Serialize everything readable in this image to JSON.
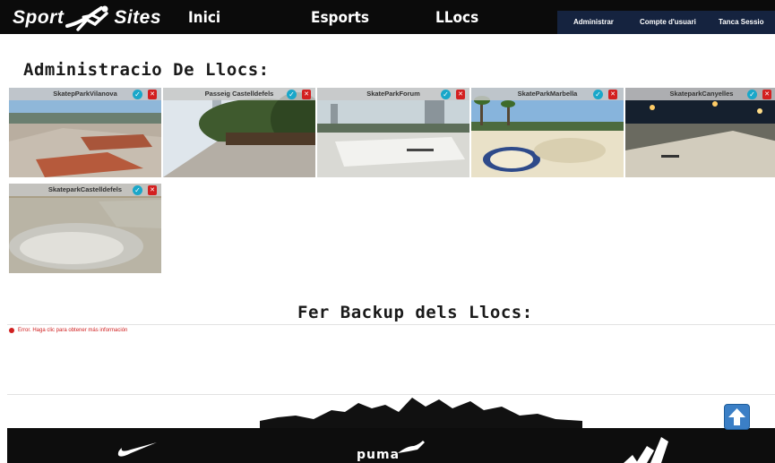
{
  "header": {
    "logo_left": "Sport",
    "logo_right": "Sites",
    "nav": [
      "Inici",
      "Esports",
      "LLocs"
    ],
    "account_links": [
      "Administrar",
      "Compte d'usuari",
      "Tanca Sessio"
    ]
  },
  "places_section": {
    "title": "Administracio De Llocs:",
    "cards": [
      {
        "label": "SkatepParkVilanova",
        "ok_icon": "check-icon",
        "delete_icon": "trash-icon"
      },
      {
        "label": "Passeig Castelldefels",
        "ok_icon": "check-icon",
        "delete_icon": "trash-icon"
      },
      {
        "label": "SkateParkForum",
        "ok_icon": "check-icon",
        "delete_icon": "trash-icon"
      },
      {
        "label": "SkateParkMarbella",
        "ok_icon": "check-icon",
        "delete_icon": "trash-icon"
      },
      {
        "label": "SkateparkCanyelles",
        "ok_icon": "check-icon",
        "delete_icon": "trash-icon"
      },
      {
        "label": "SkateparkCastelldefels",
        "ok_icon": "check-icon",
        "delete_icon": "trash-icon"
      }
    ]
  },
  "backup_section": {
    "title": "Fer Backup dels Llocs:",
    "error": "Error. Haga clic para obtener más información"
  },
  "footer": {
    "brands": [
      "nike-logo",
      "puma-logo",
      "adidas-logo"
    ],
    "puma_text": "puma",
    "scroll_top_icon": "arrow-up-icon"
  },
  "colors": {
    "topbar": "#0b0b0b",
    "account_bar": "#15233f",
    "accept": "#19a7c9",
    "delete": "#d32020",
    "scroll_top": "#3b7fc6"
  }
}
